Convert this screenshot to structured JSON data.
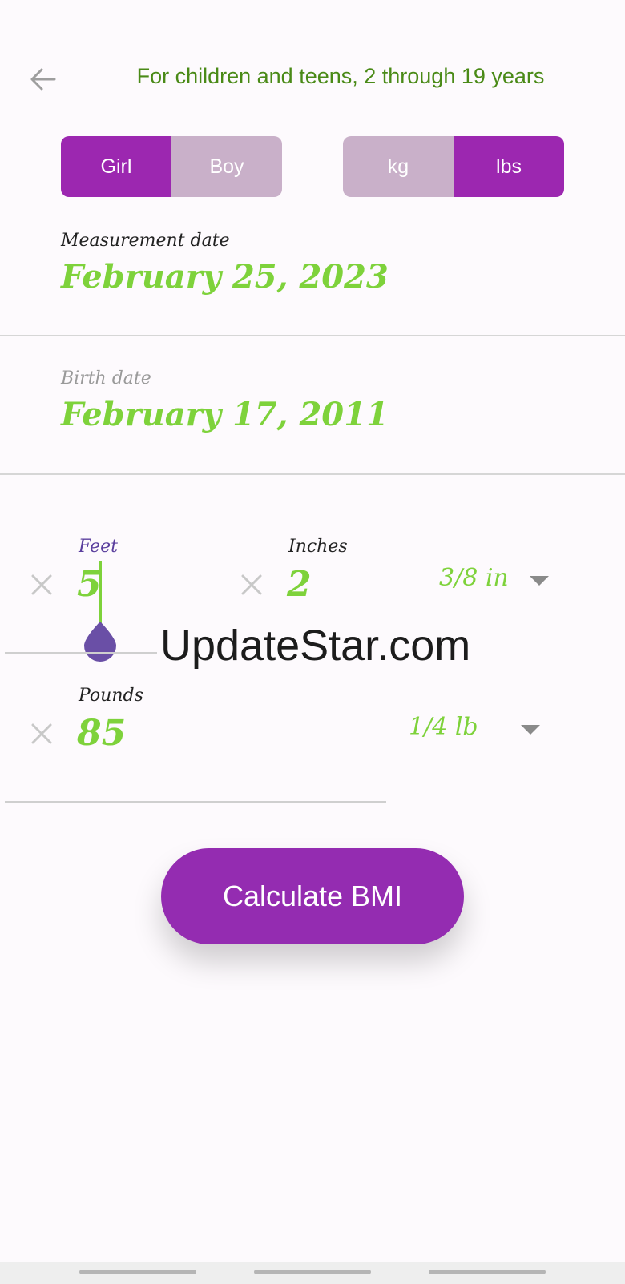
{
  "header": {
    "title": "For children and teens, 2 through 19 years",
    "back_icon": "arrow-left-icon"
  },
  "gender": {
    "options": [
      "Girl",
      "Boy"
    ],
    "selected": "Girl"
  },
  "units": {
    "options": [
      "kg",
      "lbs"
    ],
    "selected": "lbs"
  },
  "measurement_date": {
    "label": "Measurement date",
    "value": "February 25, 2023"
  },
  "birth_date": {
    "label": "Birth date",
    "value": "February 17, 2011"
  },
  "height": {
    "feet_label": "Feet",
    "feet_value": "5",
    "inches_label": "Inches",
    "inches_value": "2",
    "precision": "3/8 in"
  },
  "weight": {
    "pounds_label": "Pounds",
    "pounds_value": "85",
    "precision": "1/4 lb"
  },
  "watermark": "UpdateStar.com",
  "actions": {
    "calculate_label": "Calculate BMI"
  },
  "colors": {
    "accent": "#9c27b0",
    "inactive": "#c9b0c9",
    "value_green": "#7ed23b",
    "header_green": "#4a8a17"
  }
}
